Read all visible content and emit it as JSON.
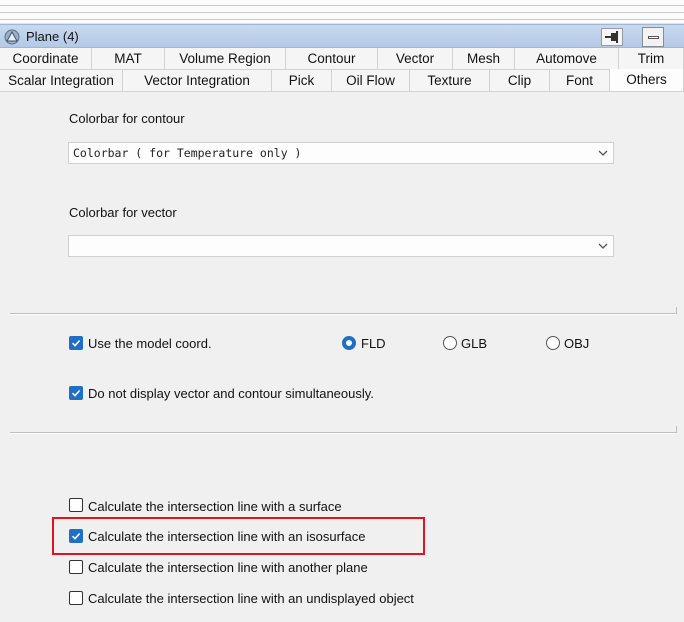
{
  "window": {
    "title": "Plane (4)"
  },
  "tabs_row1": [
    "Coordinate",
    "MAT",
    "Volume Region",
    "Contour",
    "Vector",
    "Mesh",
    "Automove",
    "Trim"
  ],
  "tabs_row2": [
    "Scalar Integration",
    "Vector Integration",
    "Pick",
    "Oil Flow",
    "Texture",
    "Clip",
    "Font",
    "Others"
  ],
  "active_tab": "Others",
  "colorbar_contour": {
    "label": "Colorbar for contour",
    "value": "Colorbar ( for Temperature only )"
  },
  "colorbar_vector": {
    "label": "Colorbar for vector",
    "value": ""
  },
  "options": {
    "use_model_coord": {
      "label": "Use the model coord.",
      "checked": true
    },
    "coord_radios": [
      {
        "label": "FLD",
        "selected": true
      },
      {
        "label": "GLB",
        "selected": false
      },
      {
        "label": "OBJ",
        "selected": false
      }
    ],
    "no_simultaneous": {
      "label": "Do not display vector and contour simultaneously.",
      "checked": true
    }
  },
  "intersection": [
    {
      "label": "Calculate the intersection line with a surface",
      "checked": false
    },
    {
      "label": "Calculate the intersection line with an isosurface",
      "checked": true
    },
    {
      "label": "Calculate the intersection line with another plane",
      "checked": false
    },
    {
      "label": "Calculate the intersection line with an undisplayed object",
      "checked": false
    }
  ],
  "colors": {
    "accent": "#1f6fc5",
    "highlight_box": "#e0141c",
    "titlebar": "#bfd1ec"
  },
  "icons": {
    "app": "app-logo-icon",
    "pin": "pin-icon",
    "minimize": "minimize-icon",
    "dropdown": "chevron-down-icon"
  }
}
